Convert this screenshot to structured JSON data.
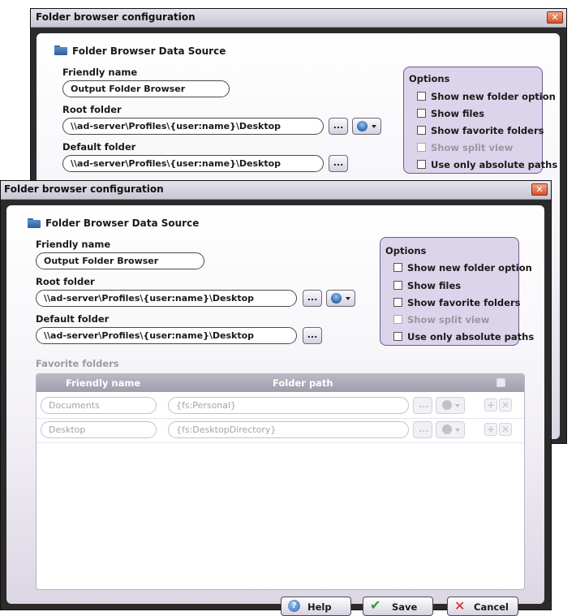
{
  "colors": {
    "accent": "#3a74b8",
    "close": "#d3532b",
    "frame": "#2b2b2b"
  },
  "back_window": {
    "title": "Folder browser configuration",
    "section_title": "Folder Browser Data Source",
    "friendly_name_label": "Friendly name",
    "friendly_name_value": "Output Folder Browser",
    "root_folder_label": "Root folder",
    "root_folder_value": "\\\\ad-server\\Profiles\\{user:name}\\Desktop",
    "default_folder_label": "Default folder",
    "default_folder_value": "\\\\ad-server\\Profiles\\{user:name}\\Desktop",
    "browse_label": "...",
    "options": {
      "title": "Options",
      "items": [
        {
          "label": "Show new folder option",
          "checked": false,
          "disabled": false
        },
        {
          "label": "Show files",
          "checked": false,
          "disabled": false
        },
        {
          "label": "Show favorite folders",
          "checked": false,
          "disabled": false
        },
        {
          "label": "Show split view",
          "checked": false,
          "disabled": true
        },
        {
          "label": "Use only absolute paths",
          "checked": false,
          "disabled": false
        }
      ]
    }
  },
  "front_window": {
    "title": "Folder browser configuration",
    "section_title": "Folder Browser Data Source",
    "friendly_name_label": "Friendly name",
    "friendly_name_value": "Output Folder Browser",
    "root_folder_label": "Root folder",
    "root_folder_value": "\\\\ad-server\\Profiles\\{user:name}\\Desktop",
    "default_folder_label": "Default folder",
    "default_folder_value": "\\\\ad-server\\Profiles\\{user:name}\\Desktop",
    "browse_label": "...",
    "options": {
      "title": "Options",
      "items": [
        {
          "label": "Show new folder option",
          "checked": false,
          "disabled": false
        },
        {
          "label": "Show files",
          "checked": false,
          "disabled": false
        },
        {
          "label": "Show favorite folders",
          "checked": false,
          "disabled": false
        },
        {
          "label": "Show split view",
          "checked": false,
          "disabled": true
        },
        {
          "label": "Use only absolute paths",
          "checked": false,
          "disabled": false
        }
      ]
    },
    "favorites": {
      "label": "Favorite folders",
      "columns": [
        "Friendly name",
        "Folder path"
      ],
      "rows": [
        {
          "name": "Documents",
          "path": "{fs:Personal}"
        },
        {
          "name": "Desktop",
          "path": "{fs:DesktopDirectory}"
        }
      ]
    },
    "footer": {
      "help": "Help",
      "save": "Save",
      "cancel": "Cancel"
    }
  }
}
